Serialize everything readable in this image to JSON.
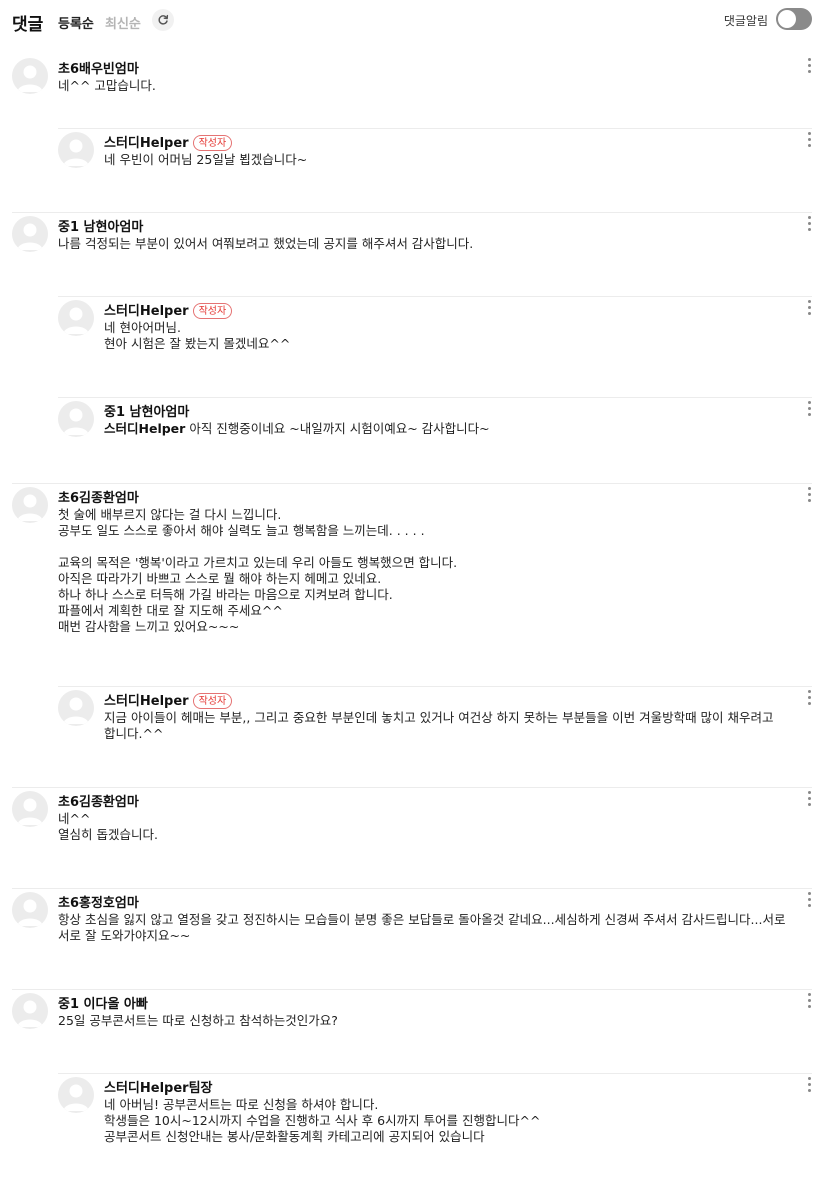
{
  "header": {
    "title": "댓글",
    "sort_registered": "등록순",
    "sort_latest": "최신순",
    "notify_label": "댓글알림",
    "notify_on": false
  },
  "badge_label": "작성자",
  "comments": [
    {
      "author": "초6배우빈엄마",
      "badge": false,
      "reply": false,
      "mention": "",
      "text": "네^^ 고맙습니다."
    },
    {
      "author": "스터디Helper",
      "badge": true,
      "reply": true,
      "mention": "",
      "text": "네 우빈이 어머님 25일날 뵙겠습니다~"
    },
    {
      "author": "중1 남현아엄마",
      "badge": false,
      "reply": false,
      "mention": "",
      "text": "나름 걱정되는 부분이 있어서 여쭤보려고 했었는데 공지를 해주셔서 감사합니다."
    },
    {
      "author": "스터디Helper",
      "badge": true,
      "reply": true,
      "mention": "",
      "text": "네 현아어머님.\n현아 시험은 잘 봤는지 몰겠네요^^"
    },
    {
      "author": "중1 남현아엄마",
      "badge": false,
      "reply": true,
      "mention": "스터디Helper",
      "text": "아직 진행중이네요 ~내일까지 시험이예요~ 감사합니다~"
    },
    {
      "author": "초6김종환엄마",
      "badge": false,
      "reply": false,
      "mention": "",
      "text": "첫 술에 배부르지 않다는 걸 다시 느낍니다.\n공부도 일도 스스로 좋아서 해야 실력도 늘고 행복함을 느끼는데. . . . .\n\n교육의 목적은 '행복'이라고 가르치고 있는데 우리 아들도 행복했으면 합니다.\n아직은 따라가기 바쁘고 스스로 뭘 해야 하는지 헤메고 있네요.\n하나 하나 스스로 터득해 가길 바라는 마음으로 지켜보려 합니다.\n파플에서 계획한 대로 잘 지도해 주세요^^\n매번 감사함을 느끼고 있어요~~~"
    },
    {
      "author": "스터디Helper",
      "badge": true,
      "reply": true,
      "mention": "",
      "text": "지금 아이들이 헤매는 부분,, 그리고 중요한 부분인데 놓치고 있거나 여건상 하지 못하는 부분들을 이번 겨울방학때 많이 채우려고 합니다.^^"
    },
    {
      "author": "초6김종환엄마",
      "badge": false,
      "reply": false,
      "mention": "",
      "text": "네^^\n열심히 돕겠습니다."
    },
    {
      "author": "초6홍정호엄마",
      "badge": false,
      "reply": false,
      "mention": "",
      "text": "항상 초심을 잃지 않고 열정을 갖고 정진하시는 모습들이 분명 좋은 보답들로 돌아올것 같네요...세심하게 신경써 주셔서 감사드립니다...서로서로 잘 도와가야지요~~"
    },
    {
      "author": "중1 이다올 아빠",
      "badge": false,
      "reply": false,
      "mention": "",
      "text": "25일 공부콘서트는 따로 신청하고 참석하는것인가요?"
    },
    {
      "author": "스터디Helper팀장",
      "badge": false,
      "reply": true,
      "mention": "",
      "text": "네 아버님! 공부콘서트는 따로 신청을 하셔야 합니다.\n학생들은 10시~12시까지 수업을 진행하고 식사 후 6시까지 투어를 진행합니다^^\n공부콘서트 신청안내는 봉사/문화활동계획 카테고리에 공지되어 있습니다"
    }
  ]
}
